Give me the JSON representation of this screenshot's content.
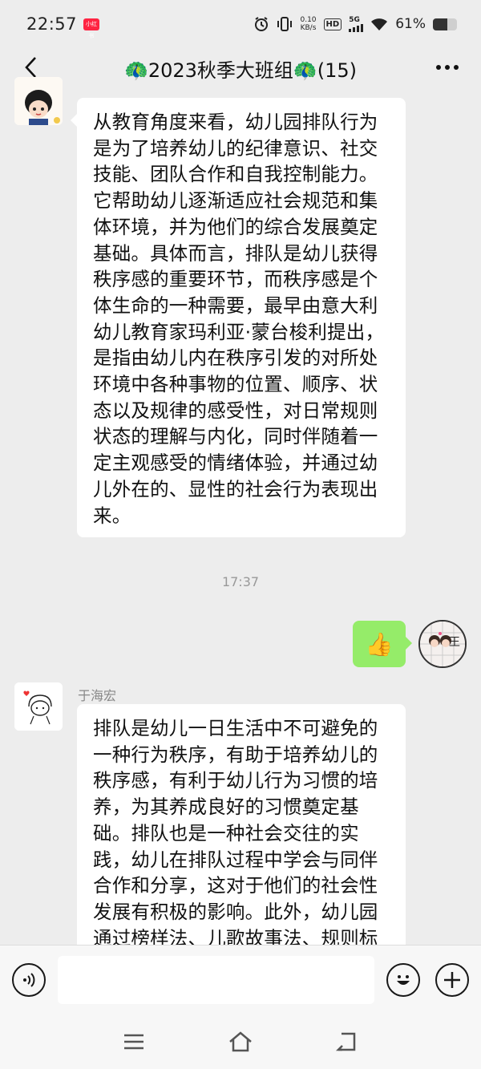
{
  "status_bar": {
    "time": "22:57",
    "app_badge": "小红书",
    "net_speed_value": "0.10",
    "net_speed_unit": "KB/s",
    "hd": "HD",
    "signal": "5G",
    "battery_percent": "61%",
    "battery_level": 0.61
  },
  "header": {
    "title": "🦚2023秋季大班组🦚(15)"
  },
  "messages": [
    {
      "side": "left",
      "text": "从教育角度来看，幼儿园排队行为是为了培养幼儿的纪律意识、社交技能、团队合作和自我控制能力。它帮助幼儿逐渐适应社会规范和集体环境，并为他们的综合发展奠定基础。具体而言，排队是幼儿获得秩序感的重要环节，而秩序感是个体生命的一种需要，最早由意大利幼儿教育家玛利亚·蒙台梭利提出，是指由幼儿内在秩序引发的对所处环境中各种事物的位置、顺序、状态以及规律的感受性，对日常规则状态的理解与内化，同时伴随着一定主观感受的情绪体验，并通过幼儿外在的、显性的社会行为表现出来。"
    },
    {
      "side": "right",
      "emoji": "👍"
    },
    {
      "side": "left",
      "sender": "于海宏",
      "text": "排队是幼儿一日生活中不可避免的一种行为秩序，有助于培养幼儿的秩序感，有利于幼儿行为习惯的培养，为其养成良好的习惯奠定基础。排队也是一种社会交往的实践，幼儿在排队过程中学会与同伴合作和分享，这对于他们的社会性发展有积极的影响。此外，幼儿园通过榜样法、儿歌故事法、规则标"
    }
  ],
  "timestamp": "17:37",
  "self_avatar_text": "王",
  "input": {
    "value": ""
  },
  "colors": {
    "background": "#ededed",
    "bubble_self": "#95ec69",
    "bubble_other": "#ffffff"
  }
}
